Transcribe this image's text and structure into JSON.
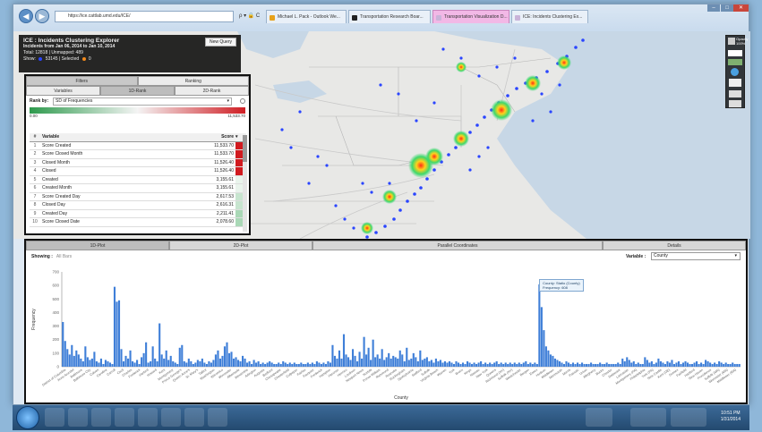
{
  "browser": {
    "address": "https://ice.cattlab.umd.edu/ICE/",
    "address_controls": "ρ ▾ 🔒 C",
    "tabs": [
      {
        "label": "Michael L. Pack - Outlook We...",
        "active": false
      },
      {
        "label": "Transportation Research Boar...",
        "active": false
      },
      {
        "label": "Transportation Visualization D...",
        "active": false
      },
      {
        "label": "ICE: Incidents Clustering Ex...",
        "active": true
      }
    ],
    "window_controls": [
      "–",
      "□",
      "✕"
    ]
  },
  "info_panel": {
    "title": "ICE : Incidents Clustering Explorer",
    "date_range": "Incidents from Jan 06, 2014 to Jan 10, 2014",
    "totals": "Total: 12818 | Unmapped: 489",
    "show_label": "Show:",
    "selected_text": "53145 | Selected",
    "selected_count": "0",
    "new_query_label": "New Query"
  },
  "map_controls": {
    "opacity_label": "Opacity",
    "opacity_value": "100%"
  },
  "left_panel": {
    "tabs_top": [
      "Filters",
      "Ranking"
    ],
    "tabs_sub": [
      "Variables",
      "1D-Rank",
      "2D-Rank"
    ],
    "active_top": "Ranking",
    "active_sub": "1D-Rank",
    "rank_by_label": "Rank by:",
    "rank_by_value": "SD of Frequencies",
    "scale_min": "0.00",
    "scale_max": "11,533.70",
    "table_headers": [
      "#",
      "Variable",
      "Score"
    ],
    "rows": [
      {
        "n": "1",
        "variable": "Score Created",
        "score": "11,533.70",
        "color": "#d11a1f"
      },
      {
        "n": "2",
        "variable": "Score Closed Month",
        "score": "11,533.70",
        "color": "#d11a1f"
      },
      {
        "n": "3",
        "variable": "Closed Month",
        "score": "11,526.40",
        "color": "#d11a1f"
      },
      {
        "n": "4",
        "variable": "Closed",
        "score": "11,526.40",
        "color": "#d11a1f"
      },
      {
        "n": "5",
        "variable": "Created",
        "score": "3,155.61",
        "color": "#e9f4ec"
      },
      {
        "n": "6",
        "variable": "Created Month",
        "score": "3,155.61",
        "color": "#e9f4ec"
      },
      {
        "n": "7",
        "variable": "Score Created Day",
        "score": "2,617.53",
        "color": "#c7e5cf"
      },
      {
        "n": "8",
        "variable": "Closed Day",
        "score": "2,616.31",
        "color": "#c7e5cf"
      },
      {
        "n": "9",
        "variable": "Created Day",
        "score": "2,211.41",
        "color": "#a9d8b6"
      },
      {
        "n": "10",
        "variable": "Score Closed Date",
        "score": "2,078.60",
        "color": "#a9d8b6"
      }
    ]
  },
  "bottom_panel": {
    "tabs": [
      "1D-Plot",
      "2D-Plot",
      "Parallel Coordinates",
      "Details"
    ],
    "active_tab": "1D-Plot",
    "showing_label": "Showing :",
    "showing_value": "All Bars",
    "variable_label": "Variable :",
    "variable_value": "County",
    "tooltip_line1": "County: Statio (County)",
    "tooltip_line2": "Frequency: 608"
  },
  "chart_data": {
    "type": "bar",
    "xlabel": "County",
    "ylabel": "Frequency",
    "ylim": [
      0,
      700
    ],
    "yticks": [
      0,
      100,
      200,
      300,
      400,
      500,
      600,
      700
    ],
    "grid": false,
    "highlight_index": 210,
    "highlight_value": 608,
    "values": [
      330,
      190,
      130,
      90,
      160,
      80,
      120,
      90,
      60,
      40,
      150,
      70,
      50,
      60,
      110,
      40,
      30,
      60,
      20,
      50,
      40,
      30,
      20,
      590,
      480,
      490,
      130,
      40,
      80,
      60,
      120,
      40,
      30,
      50,
      20,
      70,
      100,
      180,
      30,
      40,
      150,
      60,
      40,
      320,
      90,
      60,
      120,
      50,
      80,
      40,
      30,
      20,
      140,
      160,
      40,
      30,
      60,
      40,
      20,
      30,
      50,
      40,
      60,
      30,
      20,
      40,
      30,
      50,
      90,
      120,
      60,
      80,
      150,
      180,
      100,
      110,
      60,
      70,
      50,
      40,
      80,
      60,
      30,
      40,
      20,
      50,
      30,
      40,
      20,
      30,
      20,
      30,
      40,
      30,
      20,
      20,
      30,
      20,
      40,
      30,
      20,
      30,
      20,
      30,
      20,
      20,
      30,
      20,
      20,
      30,
      20,
      30,
      20,
      40,
      30,
      20,
      30,
      20,
      40,
      30,
      160,
      80,
      60,
      120,
      60,
      240,
      90,
      70,
      50,
      130,
      80,
      40,
      110,
      60,
      220,
      90,
      140,
      50,
      200,
      70,
      90,
      60,
      130,
      50,
      70,
      100,
      60,
      80,
      70,
      60,
      120,
      90,
      40,
      140,
      50,
      60,
      100,
      70,
      40,
      120,
      50,
      60,
      70,
      40,
      50,
      30,
      60,
      40,
      50,
      30,
      40,
      30,
      40,
      30,
      20,
      40,
      30,
      20,
      30,
      20,
      40,
      30,
      20,
      30,
      20,
      30,
      40,
      20,
      30,
      20,
      30,
      20,
      30,
      40,
      20,
      30,
      20,
      30,
      20,
      30,
      20,
      30,
      20,
      30,
      20,
      30,
      40,
      20,
      30,
      20,
      30,
      20,
      608,
      440,
      270,
      150,
      120,
      90,
      80,
      60,
      50,
      40,
      30,
      20,
      40,
      30,
      20,
      30,
      20,
      30,
      20,
      30,
      20,
      20,
      20,
      30,
      20,
      20,
      20,
      30,
      20,
      20,
      30,
      20,
      20,
      20,
      20,
      30,
      20,
      60,
      40,
      70,
      50,
      30,
      40,
      20,
      30,
      20,
      20,
      70,
      50,
      30,
      40,
      20,
      30,
      60,
      40,
      30,
      20,
      40,
      30,
      50,
      20,
      30,
      40,
      20,
      30,
      40,
      30,
      20,
      20,
      30,
      40,
      20,
      30,
      20,
      50,
      40,
      30,
      20,
      30,
      20,
      40,
      30,
      20,
      30,
      20,
      20,
      30,
      20,
      20,
      20
    ],
    "categories_visible": [
      "District of Columbia",
      "Anne Arundel",
      "Baltimore",
      "Baltimore City",
      "Calvert",
      "Caroline",
      "Carroll",
      "Cecil",
      "Charles",
      "Frederick",
      "Harford",
      "Howard",
      "Kent",
      "Montgomery",
      "Prince George's",
      "Queen Anne's",
      "St. Mary's",
      "Talbot",
      "Washington",
      "Wicomico",
      "Worcester",
      "Albemarle",
      "Alexandria",
      "Arlington",
      "Augusta",
      "Bedford",
      "Chesapeake",
      "Chesterfield",
      "Culpeper",
      "Fairfax",
      "Fauquier",
      "Frederick",
      "Hampton",
      "Hanover",
      "Henrico",
      "Loudoun",
      "Newport News",
      "Norfolk",
      "Prince William",
      "Richmond",
      "Roanoke",
      "Rockingham",
      "Spotsylvania",
      "Stafford",
      "Suffolk",
      "Virginia Beach",
      "Warren",
      "York",
      "Bronx",
      "Kings",
      "Nassau",
      "New York",
      "Queens",
      "Richmond (NY)",
      "Suffolk (NY)",
      "Westchester",
      "Bergen",
      "Essex",
      "Hudson",
      "Middlesex",
      "Monmouth",
      "Morris",
      "Passaic",
      "Union",
      "Allegheny",
      "Bucks",
      "Chester",
      "Delaware",
      "Lancaster",
      "Montgomery (PA)",
      "Philadelphia",
      "York (PA)",
      "New Castle",
      "Kent (DE)",
      "Sussex",
      "Fairfield",
      "Hartford",
      "New Haven",
      "Providence",
      "Suffolk (MA)",
      "Worcester (MA)",
      "Middlesex (MA)"
    ]
  },
  "taskbar": {
    "time": "10:51 PM",
    "date": "1/31/2014"
  }
}
